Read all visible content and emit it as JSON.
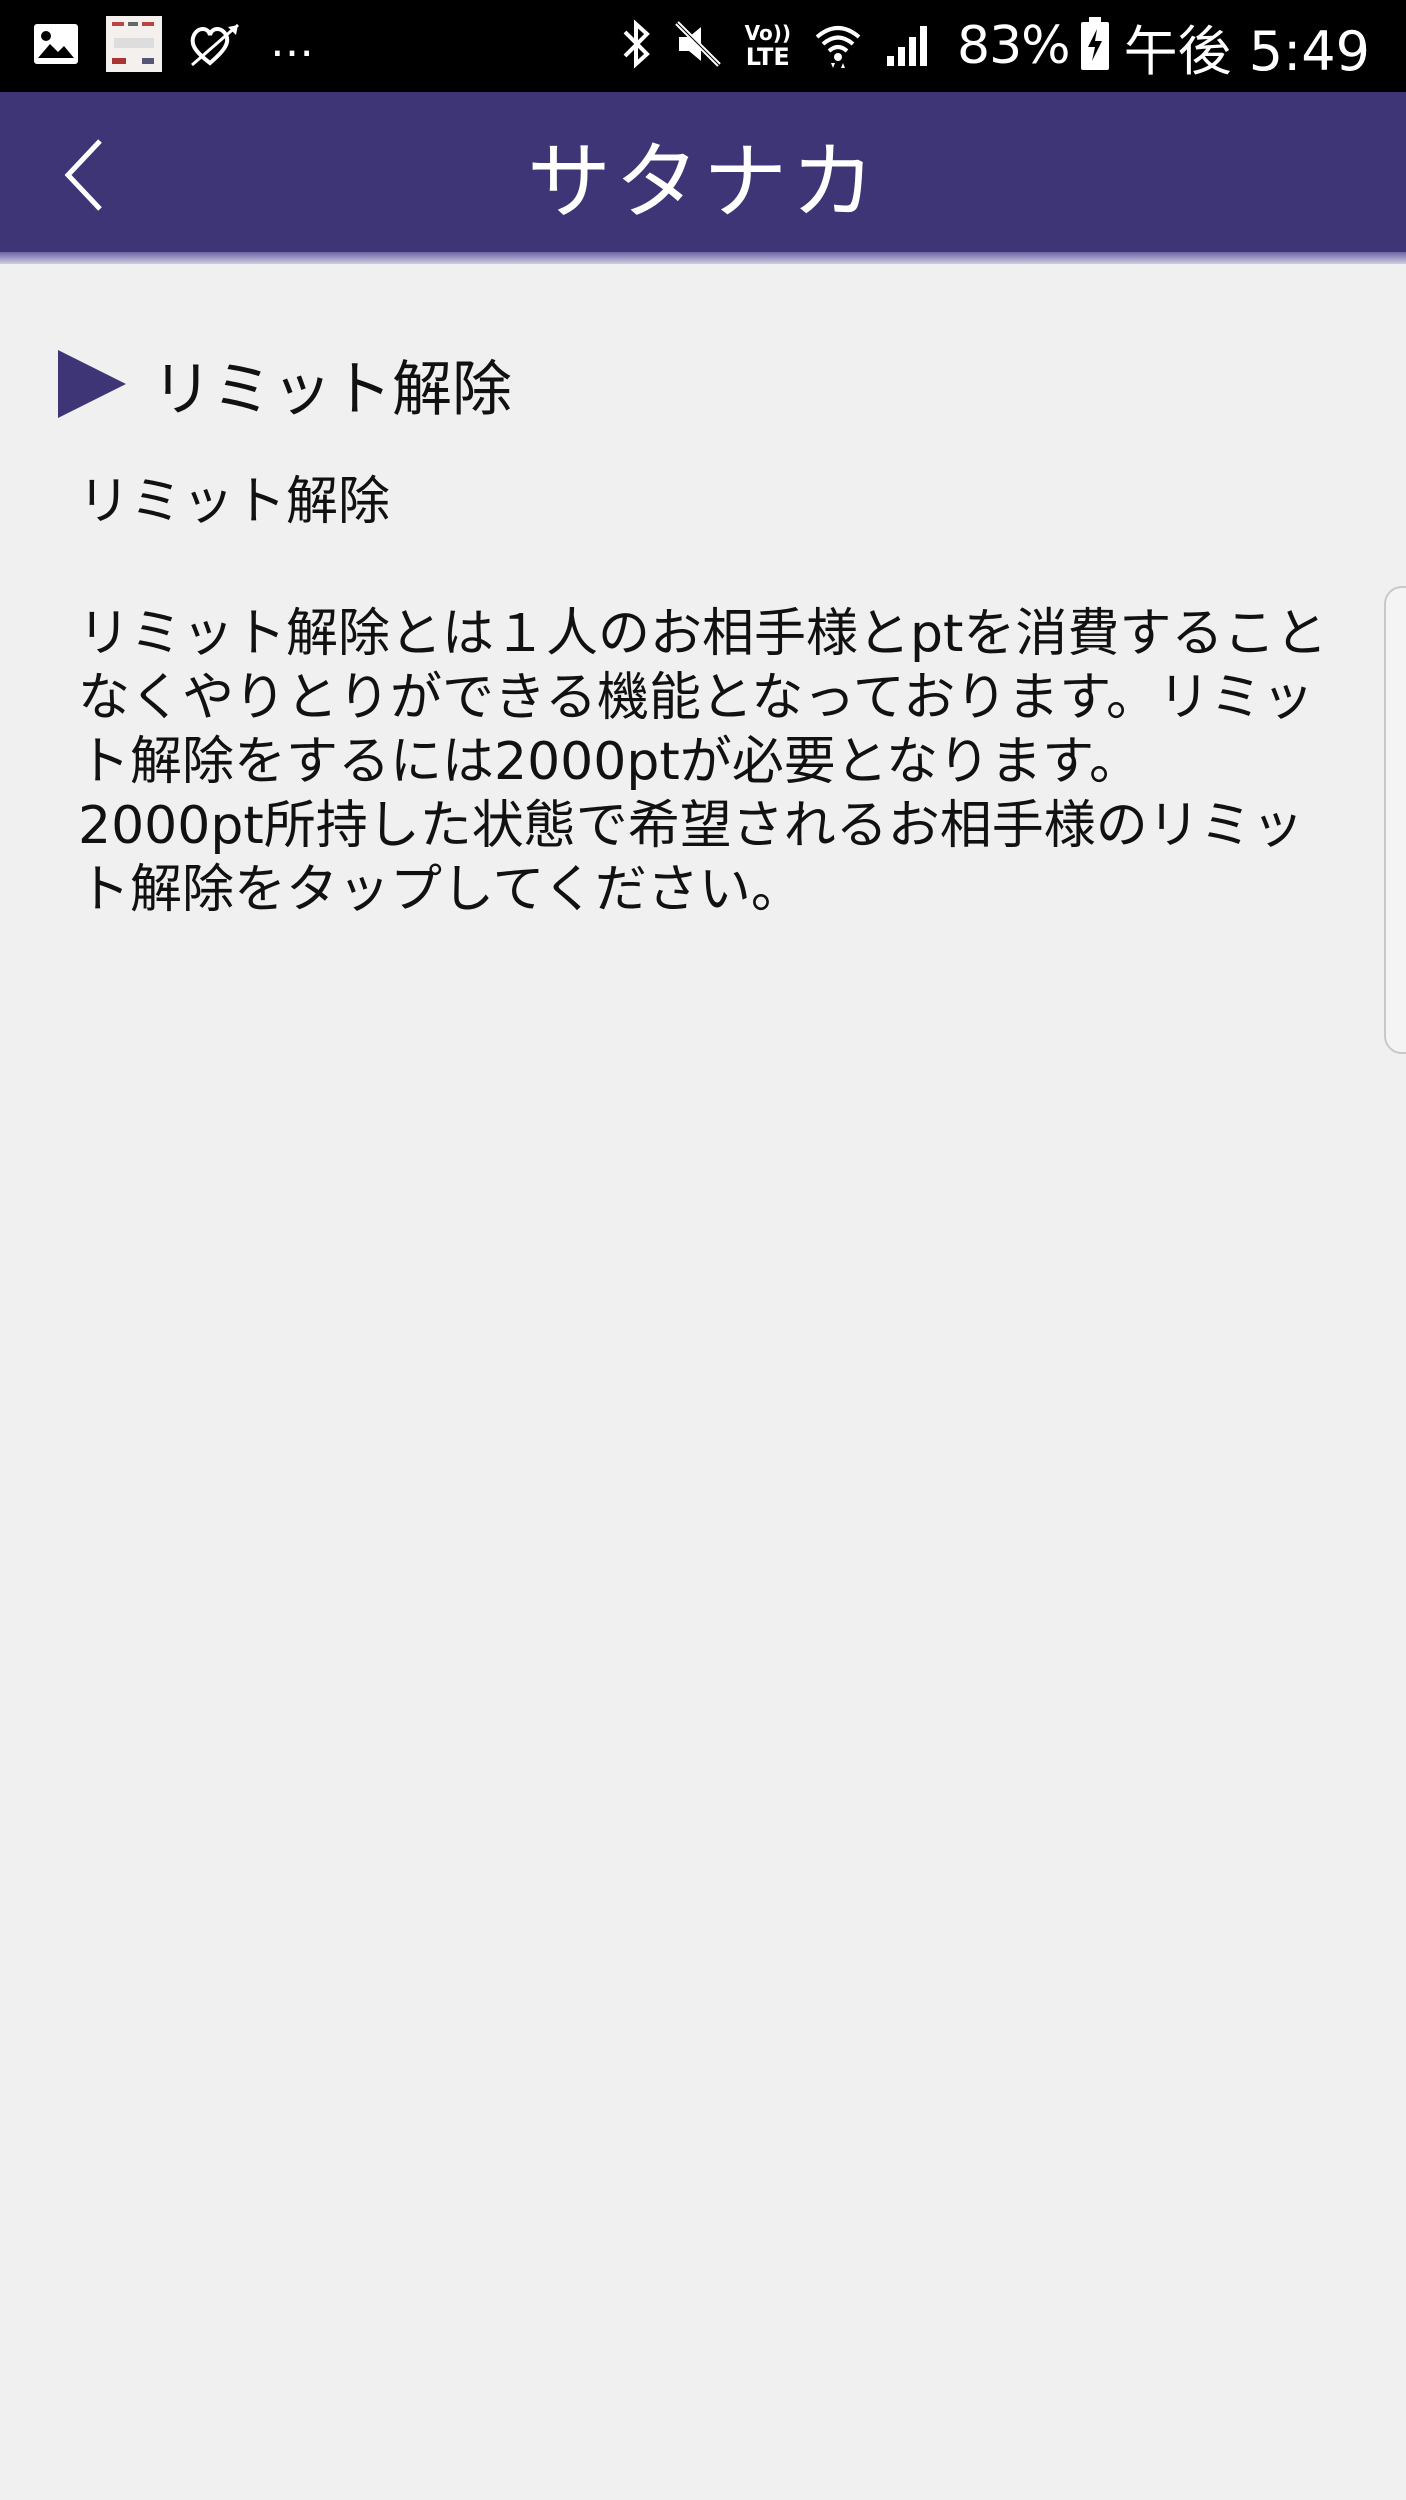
{
  "status_bar": {
    "left_icons": [
      "gallery-icon",
      "app-thumbnail-icon",
      "heart-arrow-icon"
    ],
    "overflow_text": "…",
    "right_icons": [
      "bluetooth-icon",
      "mute-icon",
      "volte-icon",
      "wifi-icon",
      "signal-icon"
    ],
    "volte_top": "Vo))",
    "volte_bottom": "LTE",
    "battery_percent": "83%",
    "time": "午後 5:49"
  },
  "app_bar": {
    "title": "サタナカ",
    "back_icon": "back-chevron-icon",
    "color": "#3d3575"
  },
  "section": {
    "heading": "リミット解除",
    "subtitle": "リミット解除",
    "body": "リミット解除とは１人のお相手様とptを消費することなくやりとりができる機能となっております。リミット解除をするには2000ptが必要となります。\n2000pt所持した状態で希望されるお相手様のリミット解除をタップしてください。"
  }
}
